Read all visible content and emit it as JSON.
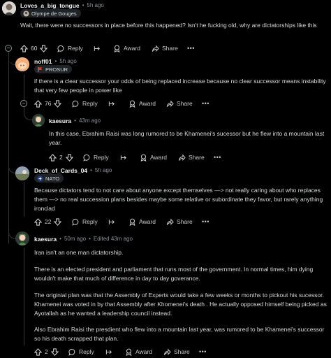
{
  "comments": [
    {
      "author": "Loves_a_big_tongue",
      "time": "5h ago",
      "flair": "Olympe de Gouges",
      "body": "Wait, there were no successors in place before this happened? Isn't he fucking old, why are dictatorships like this",
      "votes": "60",
      "actions": {
        "reply": "Reply",
        "award": "Award",
        "share": "Share",
        "more": "•••"
      }
    },
    {
      "author": "noff01",
      "time": "5h ago",
      "flair": "PROSUR",
      "body": "if there is a clear successor your odds of being replaced increase because no clear successor means instability that very few people in power like",
      "votes": "76",
      "actions": {
        "reply": "Reply",
        "award": "Award",
        "share": "Share",
        "more": "•••"
      }
    },
    {
      "author": "kaesura",
      "time": "43m ago",
      "body": "In this case, Ebrahim Raisi was long rumored to be Khamenei's sucessor but he flew into a mountain last year.",
      "votes": "2",
      "actions": {
        "reply": "Reply",
        "award": "Award",
        "share": "Share",
        "more": "•••"
      }
    },
    {
      "author": "Deck_of_Cards_04",
      "time": "5h ago",
      "flair": "NATO",
      "body": "Because dictators tend to not care about anyone except themselves —> not really caring about who replaces them —> no real succession plans besides maybe some relative or subordinate they favor, but rarely anything ironclad",
      "votes": "22",
      "actions": {
        "reply": "Reply",
        "award": "Award",
        "share": "Share",
        "more": "•••"
      }
    },
    {
      "author": "kaesura",
      "time": "50m ago",
      "edited": "Edited 43m ago",
      "paragraphs": [
        "Iran isn't an one man dictatorship.",
        "There is an elected president and parliament that runs most of the government. In normal times, him dying wouldn't make that much of difference in day to day goverance.",
        "The originial plan was that the Assembly of Experts would take a few weeks or months to pickout his sucessor. Khamenei was voted in by that Assembly after Khomenei's death . He actually opposed himself being picked as Ayotallah as he wanted a leadership council instead.",
        "Also Ebrahim Raisi the presdient who flew into a mountain last year, was rumored to be Khamenei's successor so his death scrapped that plan."
      ],
      "votes": "2",
      "actions": {
        "reply": "Reply",
        "award": "Award",
        "share": "Share",
        "more": "•••"
      }
    }
  ],
  "separator": "•",
  "collapse_symbol": "−"
}
